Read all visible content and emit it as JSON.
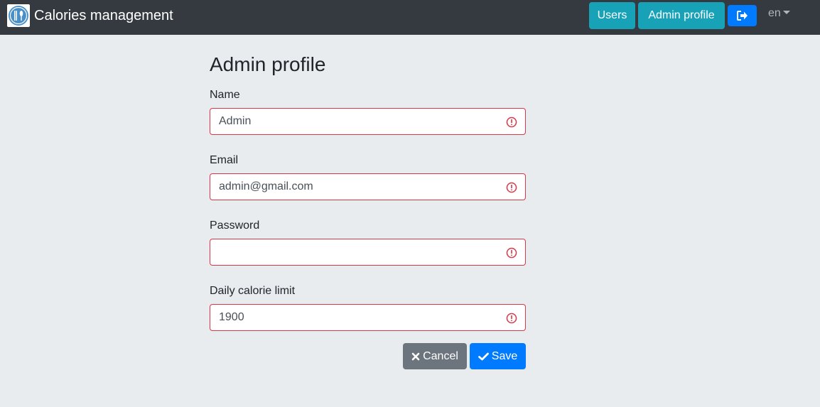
{
  "header": {
    "app_title": "Calories management",
    "logo_icon": "cutlery-icon",
    "nav": {
      "users_label": "Users",
      "admin_profile_label": "Admin profile",
      "logout_icon": "sign-out-icon",
      "language": "en"
    }
  },
  "form": {
    "title": "Admin profile",
    "fields": {
      "name": {
        "label": "Name",
        "value": "Admin"
      },
      "email": {
        "label": "Email",
        "value": "admin@gmail.com"
      },
      "password": {
        "label": "Password",
        "value": ""
      },
      "daily_limit": {
        "label": "Daily calorie limit",
        "value": "1900"
      }
    },
    "cancel_label": "Cancel",
    "save_label": "Save"
  },
  "colors": {
    "navbar": "#343a40",
    "info": "#17a2b8",
    "primary": "#007bff",
    "secondary": "#6c757d",
    "danger": "#dc3545",
    "page_background": "#e9ecef"
  }
}
